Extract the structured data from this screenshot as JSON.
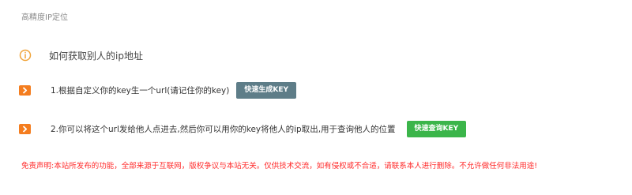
{
  "breadcrumb": {
    "title": "高精度IP定位"
  },
  "intro": {
    "text": "如何获取别人的ip地址",
    "icon": "info-circle-icon",
    "icon_color": "#f0a43a"
  },
  "steps": [
    {
      "text": "1.根据自定义你的key生一个url(请记住你的key)",
      "button_label": "快速生成KEY",
      "button_color": "#5e7d88",
      "icon": "chevron-right-icon"
    },
    {
      "text": "2.你可以将这个url发给他人点进去,然后你可以用你的key将他人的ip取出,用于查询他人的位置",
      "button_label": "快速查询KEY",
      "button_color": "#3bb54a",
      "icon": "chevron-right-icon"
    }
  ],
  "badge_color": "#f47d1f",
  "disclaimer": {
    "text": "免责声明:本站所发布的功能，全部来源于互联网，版权争议与本站无关。仅供技术交流，如有侵权或不合适，请联系本人进行删除。不允许做任何非法用途!",
    "color": "#ff2a2a"
  }
}
